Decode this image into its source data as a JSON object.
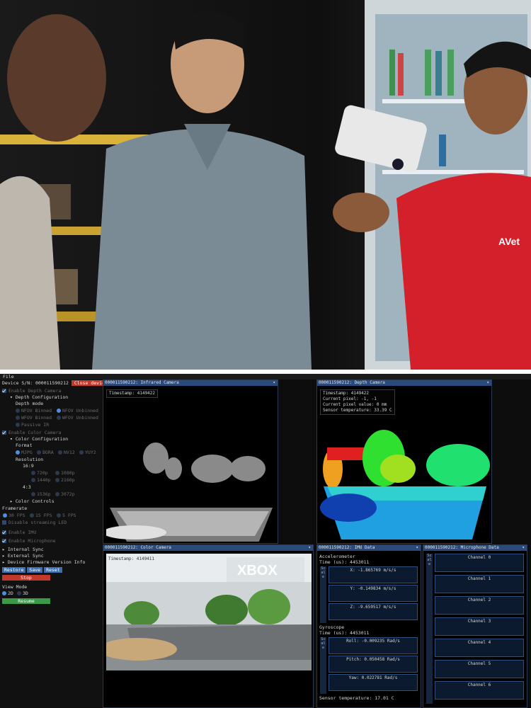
{
  "app": {
    "menu_file": "File"
  },
  "sidebar": {
    "device_sn_label": "Device S/N: 000011590212",
    "close_device": "Close device",
    "enable_depth": "Enable Depth Camera",
    "depth_config": "Depth Configuration",
    "depth_mode": "Depth mode",
    "depth_modes": [
      "NFOV Binned",
      "NFOV Unbinned",
      "WFOV Binned",
      "WFOV Unbinned",
      "Passive IR"
    ],
    "enable_color": "Enable Color Camera",
    "color_config": "Color Configuration",
    "format": "Format",
    "formats": [
      "MJPG",
      "BGRA",
      "NV12",
      "YUY2"
    ],
    "resolution": "Resolution",
    "ratio_169": "16:9",
    "res_169": [
      "720p",
      "1080p",
      "1440p",
      "2160p"
    ],
    "ratio_43": "4:3",
    "res_43": [
      "1536p",
      "3072p"
    ],
    "color_controls": "Color Controls",
    "framerate": "Framerate",
    "fps": [
      "30 FPS",
      "15 FPS",
      "5 FPS"
    ],
    "disable_led": "Disable streaming LED",
    "enable_imu": "Enable IMU",
    "enable_mic": "Enable Microphone",
    "internal_sync": "Internal Sync",
    "external_sync": "External Sync",
    "firmware": "Device Firmware Version Info",
    "restore": "Restore",
    "save": "Save",
    "reset": "Reset",
    "stop": "Stop",
    "view_mode": "View Mode",
    "view_2d": "2D",
    "view_3d": "3D",
    "resume": "Resume"
  },
  "panels": {
    "infrared": {
      "title": "000011590212: Infrared Camera",
      "timestamp": "Timestamp: 4149422"
    },
    "depth": {
      "title": "000011590212: Depth Camera",
      "timestamp": "Timestamp: 4149422",
      "current_pixel": "Current pixel: -1, -1",
      "pixel_value": "Current pixel value: 0 mm",
      "sensor_temp": "Sensor temperature: 33.39 C"
    },
    "color": {
      "title": "000011590212: Color Camera",
      "timestamp": "Timestamp: 4149411"
    },
    "imu": {
      "title": "000011590212: IMU Data",
      "accel": "Accelerometer",
      "accel_time": "Time (us): 4453011",
      "ax": "X:  -1.865769 m/s/s",
      "ay": "Y:  -0.149834 m/s/s",
      "az": "Z:  -9.659517 m/s/s",
      "gyro": "Gyroscope",
      "gyro_time": "Time (us): 4453011",
      "roll": "Roll:  -0.009235 Rad/s",
      "pitch": "Pitch:   0.050458 Rad/s",
      "yaw": "Yaw:   0.022781 Rad/s",
      "sensor_temp": "Sensor temperature: 17.01 C",
      "scale": "Scale"
    },
    "mic": {
      "title": "000011590212: Microphone Data",
      "scale": "Scale",
      "channels": [
        "Channel 0",
        "Channel 1",
        "Channel 2",
        "Channel 3",
        "Channel 4",
        "Channel 5",
        "Channel 6"
      ]
    }
  },
  "pin_glyph": "▾",
  "shirt_logo": "AVet"
}
